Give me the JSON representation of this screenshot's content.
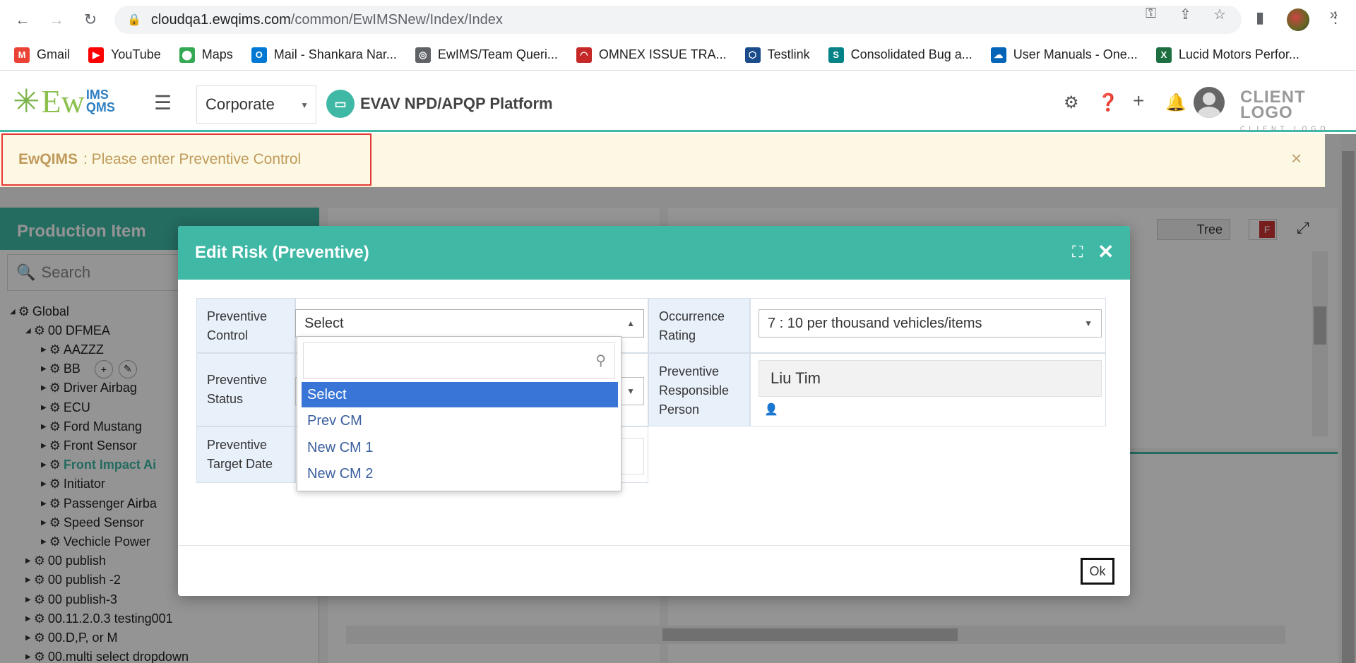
{
  "browser": {
    "url_host": "cloudqa1.ewqims.com",
    "url_path": "/common/EwIMSNew/Index/Index",
    "bookmarks": [
      {
        "label": "Gmail",
        "icon": "gmail-icon",
        "color": "#ea4335"
      },
      {
        "label": "YouTube",
        "icon": "youtube-icon",
        "color": "#ff0000"
      },
      {
        "label": "Maps",
        "icon": "maps-icon",
        "color": "#34a853"
      },
      {
        "label": "Mail - Shankara Nar...",
        "icon": "outlook-icon",
        "color": "#0078d4"
      },
      {
        "label": "EwIMS/Team Queri...",
        "icon": "globe-icon",
        "color": "#5f6368"
      },
      {
        "label": "OMNEX ISSUE TRA...",
        "icon": "omnex-icon",
        "color": "#c62828"
      },
      {
        "label": "Testlink",
        "icon": "testlink-icon",
        "color": "#1a4c8c"
      },
      {
        "label": "Consolidated Bug a...",
        "icon": "sharepoint-icon",
        "color": "#038387"
      },
      {
        "label": "User Manuals - One...",
        "icon": "onedrive-icon",
        "color": "#0364b8"
      },
      {
        "label": "Lucid Motors Perfor...",
        "icon": "excel-icon",
        "color": "#1d6f42"
      }
    ]
  },
  "header": {
    "logo_text": "Ew",
    "logo_ims": "IMS",
    "logo_qms": "QMS",
    "site_select": "Corporate",
    "platform_title": "EVAV NPD/APQP Platform",
    "client_logo": "CLIENT LOGO",
    "client_logo_sub": "CLIENT LOGO"
  },
  "alert": {
    "brand": "EwQIMS",
    "message": ": Please enter Preventive Control",
    "close": "×"
  },
  "background": {
    "left_panel_title": "Production Item",
    "search_placeholder": "Search",
    "tree_toggle": "Tree",
    "f_badge": "F",
    "tree": [
      {
        "label": "Global",
        "level": 0
      },
      {
        "label": "00 DFMEA",
        "level": 1
      },
      {
        "label": "AAZZZ",
        "level": 2
      },
      {
        "label": "BB",
        "level": 2
      },
      {
        "label": "Driver Airbag",
        "level": 2
      },
      {
        "label": "ECU",
        "level": 2
      },
      {
        "label": "Ford Mustang",
        "level": 2
      },
      {
        "label": "Front Sensor",
        "level": 2
      },
      {
        "label": "Front Impact Ai",
        "level": 2,
        "active": true
      },
      {
        "label": "Initiator",
        "level": 2
      },
      {
        "label": "Passenger Airba",
        "level": 2
      },
      {
        "label": "Speed Sensor",
        "level": 2
      },
      {
        "label": "Vechicle Power",
        "level": 2
      },
      {
        "label": "00 publish",
        "level": 1
      },
      {
        "label": "00 publish -2",
        "level": 1
      },
      {
        "label": "00 publish-3",
        "level": 1
      },
      {
        "label": "00.11.2.0.3 testing001",
        "level": 1
      },
      {
        "label": "00.D,P, or M",
        "level": 1
      },
      {
        "label": "00.multi select dropdown",
        "level": 1
      }
    ]
  },
  "modal": {
    "title": "Edit Risk (Preventive)",
    "ok_label": "Ok",
    "fields": {
      "preventive_control_label": "Preventive Control",
      "preventive_control_value": "Select",
      "preventive_status_label": "Preventive Status",
      "preventive_target_date_label": "Preventive Target Date",
      "occurrence_rating_label": "Occurrence Rating",
      "occurrence_rating_value": "7 : 10 per thousand vehicles/items",
      "responsible_person_label": "Preventive Responsible Person",
      "responsible_person_value": "Liu Tim"
    },
    "dropdown": {
      "search_value": "",
      "options": [
        "Select",
        "Prev CM",
        "New CM 1",
        "New CM 2"
      ],
      "selected": "Select"
    }
  },
  "colors": {
    "accent": "#3fb8a5",
    "alert_bg": "#fcf8e3",
    "alert_border": "#e53935",
    "label_bg": "#e8f0fa",
    "dropdown_selected": "#3875d7"
  }
}
